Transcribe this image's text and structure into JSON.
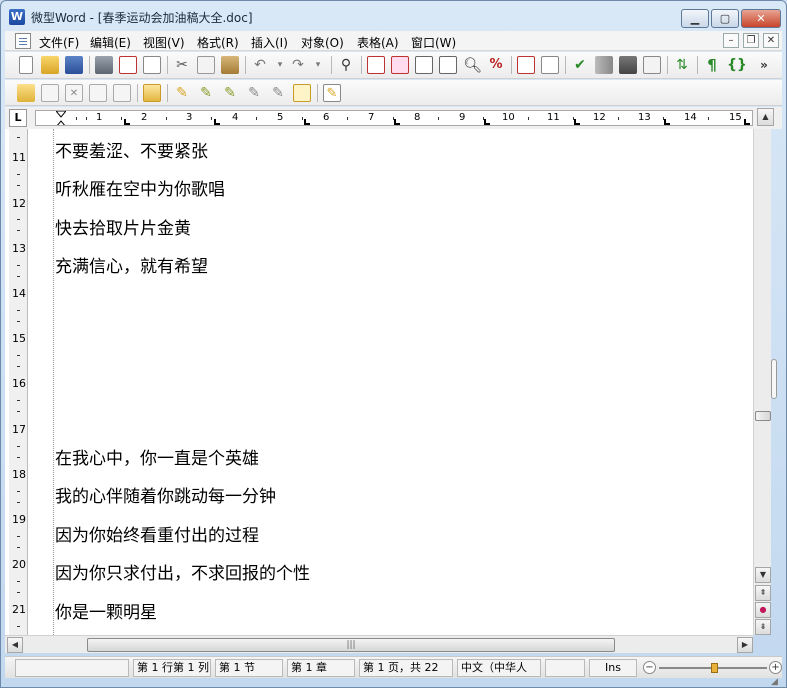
{
  "window": {
    "app_icon_letter": "W",
    "title": "微型Word - [春季运动会加油稿大全.doc]",
    "minimize_glyph": "▁",
    "maximize_glyph": "▢",
    "close_glyph": "✕"
  },
  "menu": {
    "items": [
      "文件(F)",
      "编辑(E)",
      "视图(V)",
      "格式(R)",
      "插入(I)",
      "对象(O)",
      "表格(A)",
      "窗口(W)"
    ],
    "mdi_minimize": "–",
    "mdi_restore": "❐",
    "mdi_close": "✕"
  },
  "toolbar1": {
    "overflow": "»"
  },
  "ruler": {
    "tab_selector": "L",
    "numbers": [
      "1",
      "2",
      "3",
      "4",
      "5",
      "6",
      "7",
      "8",
      "9",
      "10",
      "11",
      "12",
      "13",
      "14",
      "15"
    ]
  },
  "vertical_ruler": {
    "numbers": [
      "11",
      "12",
      "13",
      "14",
      "15",
      "16",
      "17",
      "18",
      "19",
      "20",
      "21"
    ]
  },
  "document": {
    "lines": [
      "不要羞涩、不要紧张",
      "听秋雁在空中为你歌唱",
      "快去拾取片片金黄",
      "充满信心，就有希望",
      "在我心中，你一直是个英雄",
      "我的心伴随着你跳动每一分钟",
      "因为你始终看重付出的过程",
      "因为你只求付出，不求回报的个性",
      "你是一颗明星"
    ]
  },
  "scrollbars": {
    "up_arrow": "▲",
    "down_arrow": "▼",
    "prev_page": "⇞",
    "select_browse": "●",
    "next_page": "⇟",
    "left_arrow": "◀",
    "right_arrow": "▶",
    "thumb_grip": "|||"
  },
  "status": {
    "cell_blank": "",
    "position": "第 1 行第 1 列",
    "section": "第 1 节",
    "chapter": "第 1 章",
    "page": "第 1 页，共 22",
    "language": "中文（中华人",
    "mode_blank": "",
    "ins": "Ins",
    "zoom_minus": "−",
    "zoom_plus": "+"
  },
  "colors": {
    "title_bar": "#c2d8ef",
    "close_button": "#c7452a",
    "zoom_knob": "#e8b23a"
  }
}
